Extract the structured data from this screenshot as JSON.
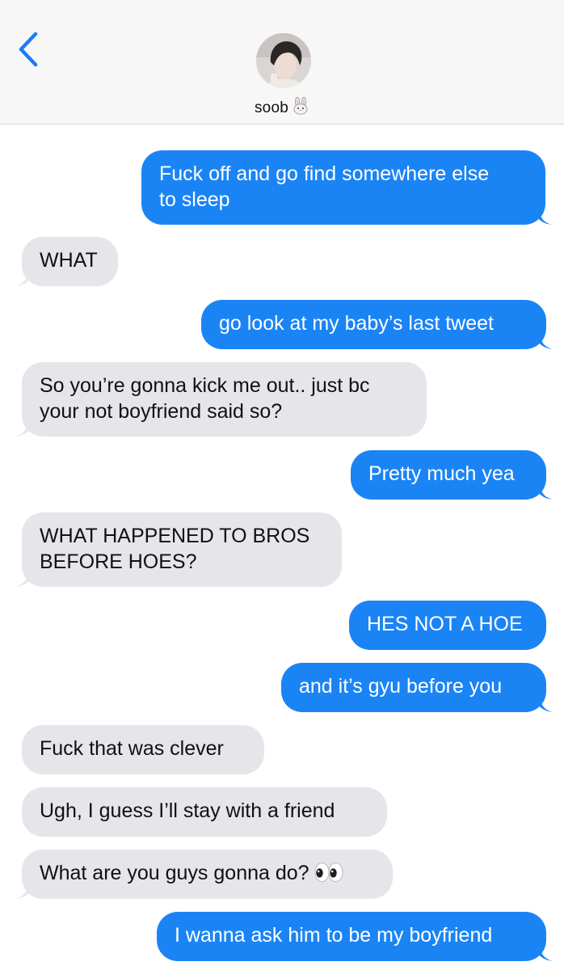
{
  "header": {
    "contact_name": "soob",
    "contact_emoji": "rabbit-face-icon",
    "avatar": "contact-avatar-photo"
  },
  "colors": {
    "outgoing": "#1b84f5",
    "incoming": "#e5e5ea",
    "accent": "#1a7cf5",
    "header_bg": "#f7f7f7"
  },
  "messages": [
    {
      "direction": "out",
      "lines": [
        "Fuck off and go find somewhere else",
        "to sleep"
      ]
    },
    {
      "direction": "in",
      "lines": [
        "WHAT"
      ]
    },
    {
      "direction": "out",
      "lines": [
        "go look at my baby’s last tweet"
      ]
    },
    {
      "direction": "in",
      "lines": [
        "So you’re gonna kick me out.. just bc",
        "your not boyfriend said so?"
      ]
    },
    {
      "direction": "out",
      "lines": [
        "Pretty much yea"
      ]
    },
    {
      "direction": "in",
      "lines": [
        "WHAT HAPPENED TO BROS",
        "BEFORE HOES?"
      ]
    },
    {
      "direction": "out",
      "lines": [
        "HES NOT A HOE"
      ]
    },
    {
      "direction": "out",
      "lines": [
        "and it’s gyu before you"
      ]
    },
    {
      "direction": "in",
      "lines": [
        "Fuck that was clever"
      ]
    },
    {
      "direction": "in",
      "lines": [
        "Ugh, I guess I’ll stay with a friend"
      ]
    },
    {
      "direction": "in",
      "lines": [
        "What are you guys gonna do?"
      ],
      "emoji": "eyes-icon"
    },
    {
      "direction": "out",
      "lines": [
        "I wanna ask him to be my boyfriend"
      ]
    }
  ]
}
